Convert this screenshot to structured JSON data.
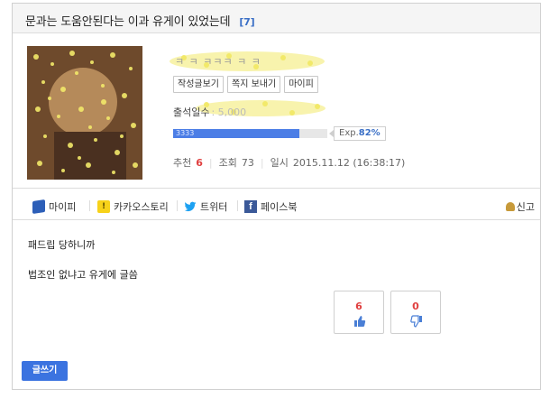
{
  "post": {
    "title": "문과는 도움안된다는 이과 유게이 있었는데",
    "comment_count": "[7]"
  },
  "author": {
    "nickname": "ㅋ ㅋ ㅋㅋㅋ ㅋ ㅋ",
    "buttons": {
      "view_posts": "작성글보기",
      "send_message": "쪽지 보내기",
      "mypi": "마이피"
    },
    "attendance_label": "출석일수",
    "attendance_value": ": 5,000",
    "exp": {
      "bar_label": "3333",
      "label": "Exp.",
      "percent_text": "82%",
      "percent": 82
    }
  },
  "stats": {
    "recommend_label": "추천",
    "recommend_value": "6",
    "views_label": "조회",
    "views_value": "73",
    "date_label": "일시",
    "date_value": "2015.11.12 (16:38:17)"
  },
  "share": {
    "mypi": "마이피",
    "kakao": "카카오스토리",
    "twitter": "트위터",
    "facebook": "페이스북",
    "report": "신고"
  },
  "content": {
    "line1": "패드립 당하니까",
    "line2": "법조인 없냐고 유게에 글씀"
  },
  "votes": {
    "up": "6",
    "down": "0"
  },
  "actions": {
    "write": "글쓰기"
  },
  "colors": {
    "accent": "#3b73e0",
    "exp_fill": "#4c7ee6",
    "highlight_red": "#e04040",
    "link_blue": "#3a6fc6"
  }
}
